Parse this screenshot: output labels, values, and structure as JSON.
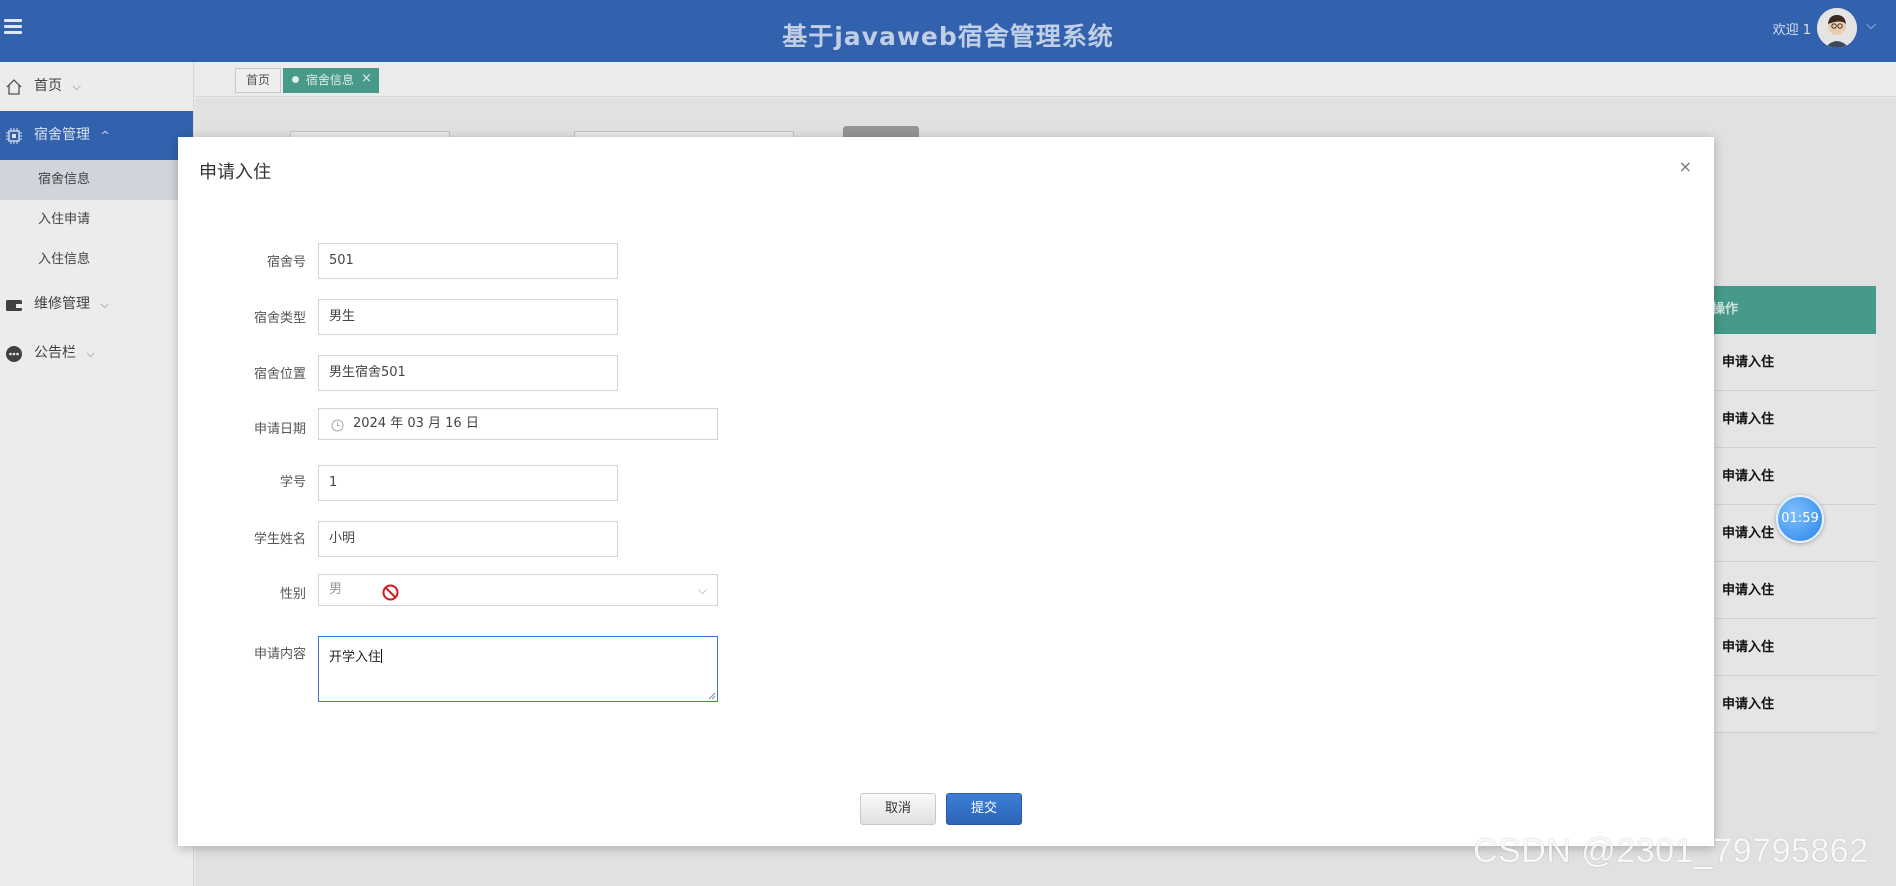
{
  "header": {
    "title": "基于javaweb宿舍管理系统",
    "welcome": "欢迎 1",
    "menu_icon": "hamburger-icon",
    "avatar_icon": "user-avatar",
    "chevron": "⌵",
    "brand_color": "#3465b4"
  },
  "sidebar": {
    "items": [
      {
        "label": "首页",
        "icon": "home-icon",
        "chevron": "⌵"
      },
      {
        "label": "宿舍管理",
        "icon": "chip-icon",
        "chevron": "^",
        "active": true
      },
      {
        "label": "维修管理",
        "icon": "wallet-icon",
        "chevron": "⌵"
      },
      {
        "label": "公告栏",
        "icon": "chat-bubble-icon",
        "chevron": "⌵"
      }
    ],
    "sub_items": [
      {
        "label": "宿舍信息",
        "active": true
      },
      {
        "label": "入住申请"
      },
      {
        "label": "入住信息"
      }
    ]
  },
  "tabs": {
    "home": "首页",
    "current": "宿舍信息",
    "close": "×"
  },
  "table": {
    "header": "操作",
    "rows": [
      "申请入住",
      "申请入住",
      "申请入住",
      "申请入住",
      "申请入住",
      "申请入住",
      "申请入住"
    ],
    "header_color": "#4a9e8e"
  },
  "modal": {
    "title": "申请入住",
    "close": "×",
    "fields": {
      "dorm_no": {
        "label": "宿舍号",
        "value": "501"
      },
      "dorm_type": {
        "label": "宿舍类型",
        "value": "男生"
      },
      "dorm_location": {
        "label": "宿舍位置",
        "value": "男生宿舍501"
      },
      "apply_date": {
        "label": "申请日期",
        "value": "2024 年 03 月 16 日"
      },
      "student_id": {
        "label": "学号",
        "value": "1"
      },
      "student_name": {
        "label": "学生姓名",
        "value": "小明"
      },
      "gender": {
        "label": "性别",
        "value": "男",
        "chevron": "⌵"
      },
      "content": {
        "label": "申请内容",
        "value": "开学入住"
      }
    },
    "cancel_label": "取消",
    "submit_label": "提交"
  },
  "timer": "01:59",
  "watermark": "CSDN @2301_79795862"
}
